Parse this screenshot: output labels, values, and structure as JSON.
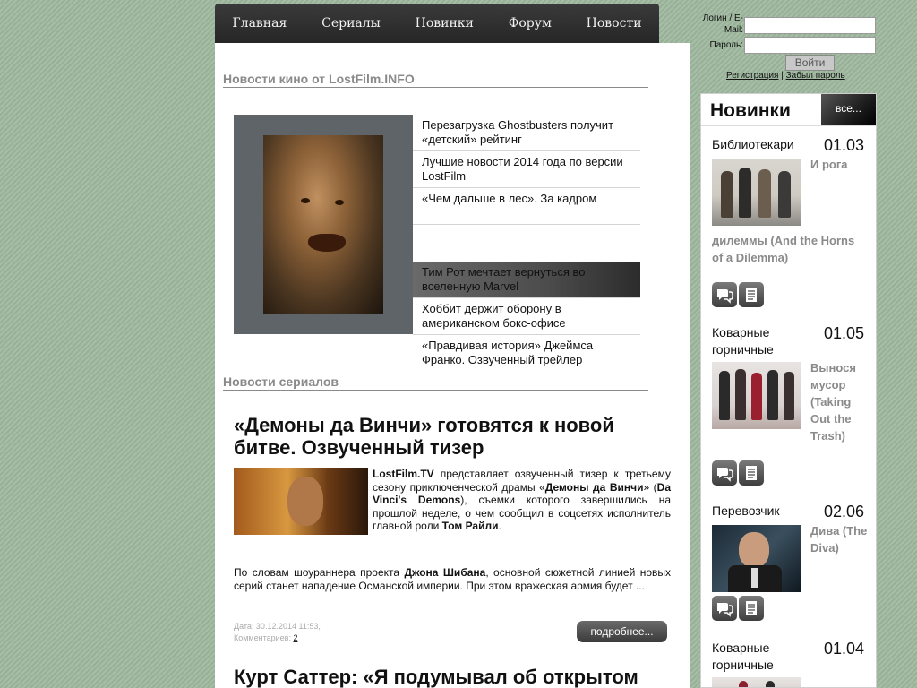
{
  "nav": {
    "items": [
      {
        "label": "Главная"
      },
      {
        "label": "Сериалы"
      },
      {
        "label": "Новинки"
      },
      {
        "label": "Форум"
      },
      {
        "label": "Новости"
      }
    ]
  },
  "login": {
    "login_label": "Логин / E-Mail:",
    "password_label": "Пароль:",
    "login_value": "",
    "password_value": "",
    "button_label": "Войти",
    "register_link": "Регистрация",
    "separator": "|",
    "forgot_link": "Забыл пароль"
  },
  "main": {
    "movie_news_title": "Новости кино от LostFilm.INFO",
    "slider_items": [
      {
        "text": "Перезагрузка Ghostbusters получит «детский» рейтинг"
      },
      {
        "text": "Лучшие новости 2014 года по версии LostFilm"
      },
      {
        "text": "«Чем дальше в лес». За кадром"
      },
      {
        "text": ""
      },
      {
        "text": "Тим Рот мечтает вернуться во вселенную Marvel"
      },
      {
        "text": "Хоббит держит оборону в американском бокс-офисе"
      },
      {
        "text": "«Правдивая история» Джеймса Франко. Озвученный трейлер"
      }
    ],
    "series_news_title": "Новости сериалов",
    "article": {
      "title": "«Демоны да Винчи» готовятся к новой битве. Озвученный тизер",
      "p1_site": "LostFilm.TV",
      "p1_text1": " представляет озвученный тизер к третьему сезону приключенческой драмы «",
      "p1_show": "Демоны да Винчи",
      "p1_text2": "» (",
      "p1_show_en": "Da Vinci's Demons",
      "p1_text3": "), съемки которого завершились на прошлой неделе, о чем сообщил в соцсетях исполнитель главной роли ",
      "p1_actor": "Том Райли",
      "p1_end": ".",
      "p2_text1": "По словам шоураннера проекта ",
      "p2_name": "Джона Шибана",
      "p2_text2": ", основной сюжетной линией новых серий станет нападение Османской империи. При этом вражеская армия будет ...",
      "date_label": "Дата: 30.12.2014 11:53,",
      "comments_label": "Комментариев: ",
      "comments_count": "2",
      "more_button": "подробнее..."
    },
    "next_article_title": "Курт Саттер: «Я подумывал об открытом"
  },
  "sidebar": {
    "title": "Новинки",
    "all_button": "все...",
    "entries": [
      {
        "title": "Библиотекари",
        "date": "01.03",
        "subtitle_side": "И рога",
        "subtitle_full": "дилеммы (And the Horns of a Dilemma)"
      },
      {
        "title": "Коварные горничные",
        "date": "01.05",
        "subtitle_side": "Вынося мусор (Taking Out the Trash)",
        "subtitle_full": ""
      },
      {
        "title": "Перевозчик",
        "date": "02.06",
        "subtitle_side": "Дива (The Diva)",
        "subtitle_full": ""
      },
      {
        "title": "Коварные горничные",
        "date": "01.04",
        "subtitle_side": "",
        "subtitle_full": ""
      }
    ]
  },
  "colors": {
    "background": "#9cb69c",
    "nav_bar": "#2f2f2f",
    "section_title": "#8a8a8a",
    "button_dark": "#4a4a4a"
  },
  "icons": {
    "comments": "speech-bubbles-icon",
    "description": "document-icon"
  }
}
